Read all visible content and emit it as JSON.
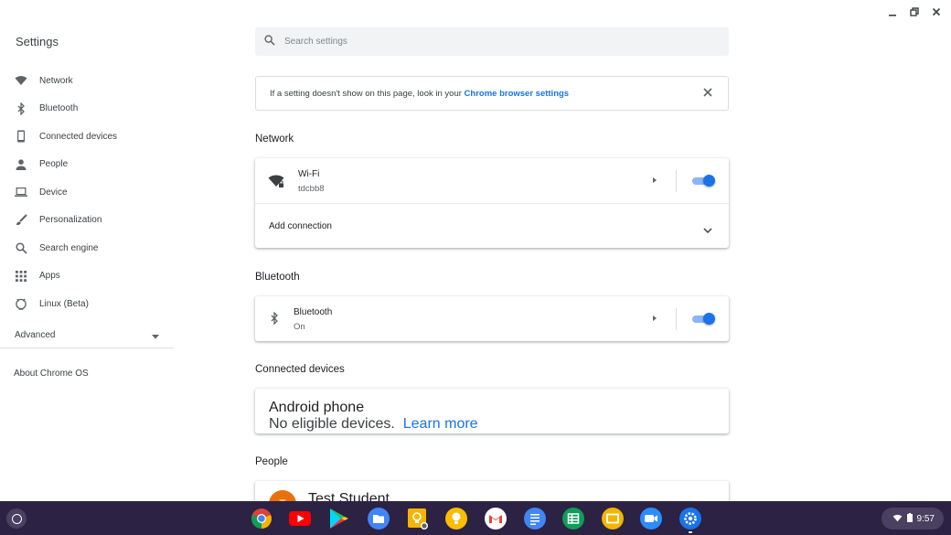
{
  "window": {
    "minimize": "–",
    "restore": "⧉",
    "close": "✕"
  },
  "nav": {
    "title": "Settings",
    "items": [
      {
        "label": "Network",
        "icon": "wifi-icon"
      },
      {
        "label": "Bluetooth",
        "icon": "bluetooth-icon"
      },
      {
        "label": "Connected devices",
        "icon": "phone-icon"
      },
      {
        "label": "People",
        "icon": "person-icon"
      },
      {
        "label": "Device",
        "icon": "laptop-icon"
      },
      {
        "label": "Personalization",
        "icon": "brush-icon"
      },
      {
        "label": "Search engine",
        "icon": "search-icon"
      },
      {
        "label": "Apps",
        "icon": "apps-grid-icon"
      },
      {
        "label": "Linux (Beta)",
        "icon": "linux-icon"
      }
    ],
    "advanced": "Advanced",
    "about": "About Chrome OS"
  },
  "search": {
    "placeholder": "Search settings",
    "value": ""
  },
  "banner": {
    "text": "If a setting doesn't show on this page, look in your ",
    "link": "Chrome browser settings"
  },
  "network": {
    "title": "Network",
    "wifi_label": "Wi-Fi",
    "wifi_network": "tdcbb8",
    "wifi_on": true,
    "add_connection": "Add connection"
  },
  "bluetooth": {
    "title": "Bluetooth",
    "label": "Bluetooth",
    "status": "On",
    "on": true
  },
  "connected": {
    "title": "Connected devices",
    "device_label": "Android phone",
    "device_status": "No eligible devices.",
    "learn_more": "Learn more"
  },
  "people": {
    "title": "People",
    "user_name": "Test Student",
    "user_initial": "T"
  },
  "shelf": {
    "apps": [
      "chrome",
      "youtube",
      "play-store",
      "files",
      "keep-pin",
      "keep",
      "gmail",
      "docs",
      "sheets",
      "slides",
      "zoom",
      "settings"
    ],
    "time": "9:57"
  },
  "colors": {
    "accent": "#1a73e8",
    "shelf": "#2b2244"
  }
}
